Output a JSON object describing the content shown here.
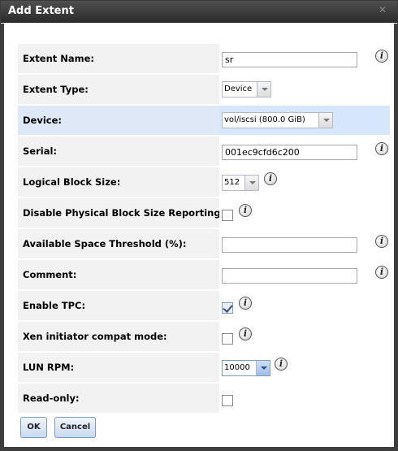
{
  "window": {
    "title": "Add Extent",
    "close_icon": "close-icon"
  },
  "form": {
    "extent_name": {
      "label": "Extent Name:",
      "value": "sr"
    },
    "extent_type": {
      "label": "Extent Type:",
      "value": "Device"
    },
    "device": {
      "label": "Device:",
      "value": "vol/iscsi (800.0 GiB)"
    },
    "serial": {
      "label": "Serial:",
      "value": "001ec9cfd6c200"
    },
    "logical_block_size": {
      "label": "Logical Block Size:",
      "value": "512"
    },
    "disable_pbs_reporting": {
      "label": "Disable Physical Block Size Reporting:",
      "checked": false
    },
    "available_space_threshold": {
      "label": "Available Space Threshold (%):",
      "value": ""
    },
    "comment": {
      "label": "Comment:",
      "value": ""
    },
    "enable_tpc": {
      "label": "Enable TPC:",
      "checked": true
    },
    "xen_compat": {
      "label": "Xen initiator compat mode:",
      "checked": false
    },
    "lun_rpm": {
      "label": "LUN RPM:",
      "value": "10000"
    },
    "read_only": {
      "label": "Read-only:",
      "checked": false
    }
  },
  "buttons": {
    "ok": "OK",
    "cancel": "Cancel"
  },
  "info_glyph": "i",
  "colors": {
    "titlebar": "#3a3a3a",
    "highlight_row": "#d6e6fb",
    "label_bg": "#f2f2f2"
  }
}
